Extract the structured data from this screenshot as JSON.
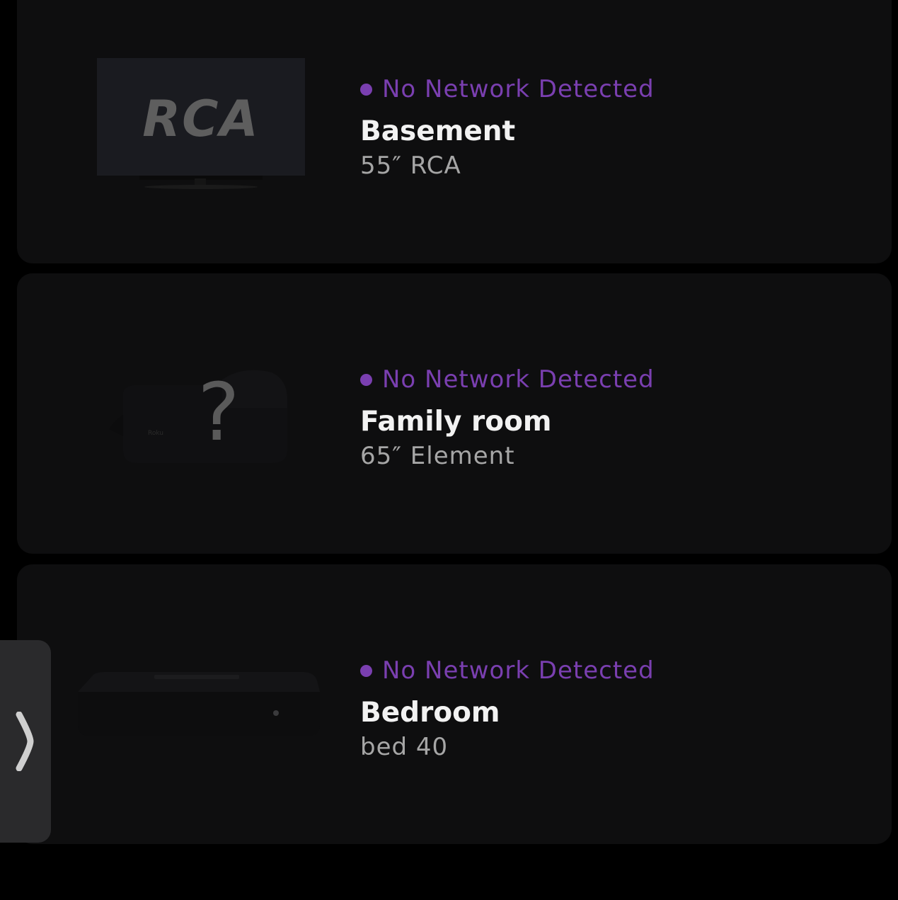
{
  "devices": [
    {
      "status": "No Network Detected",
      "name": "Basement",
      "model": "55″ RCA",
      "image": "tv-icon",
      "brand_logo": "RCA"
    },
    {
      "status": "No Network Detected",
      "name": "Family room",
      "model": "65″ Element",
      "image": "unknown-device-icon"
    },
    {
      "status": "No Network Detected",
      "name": "Bedroom",
      "model": "bed 40",
      "image": "streaming-box-icon"
    }
  ],
  "colors": {
    "status": "#7a3fb0",
    "card_bg": "#0e0e0f",
    "page_bg": "#000000"
  },
  "side_tab": {
    "icon": "chevron-right-icon"
  }
}
